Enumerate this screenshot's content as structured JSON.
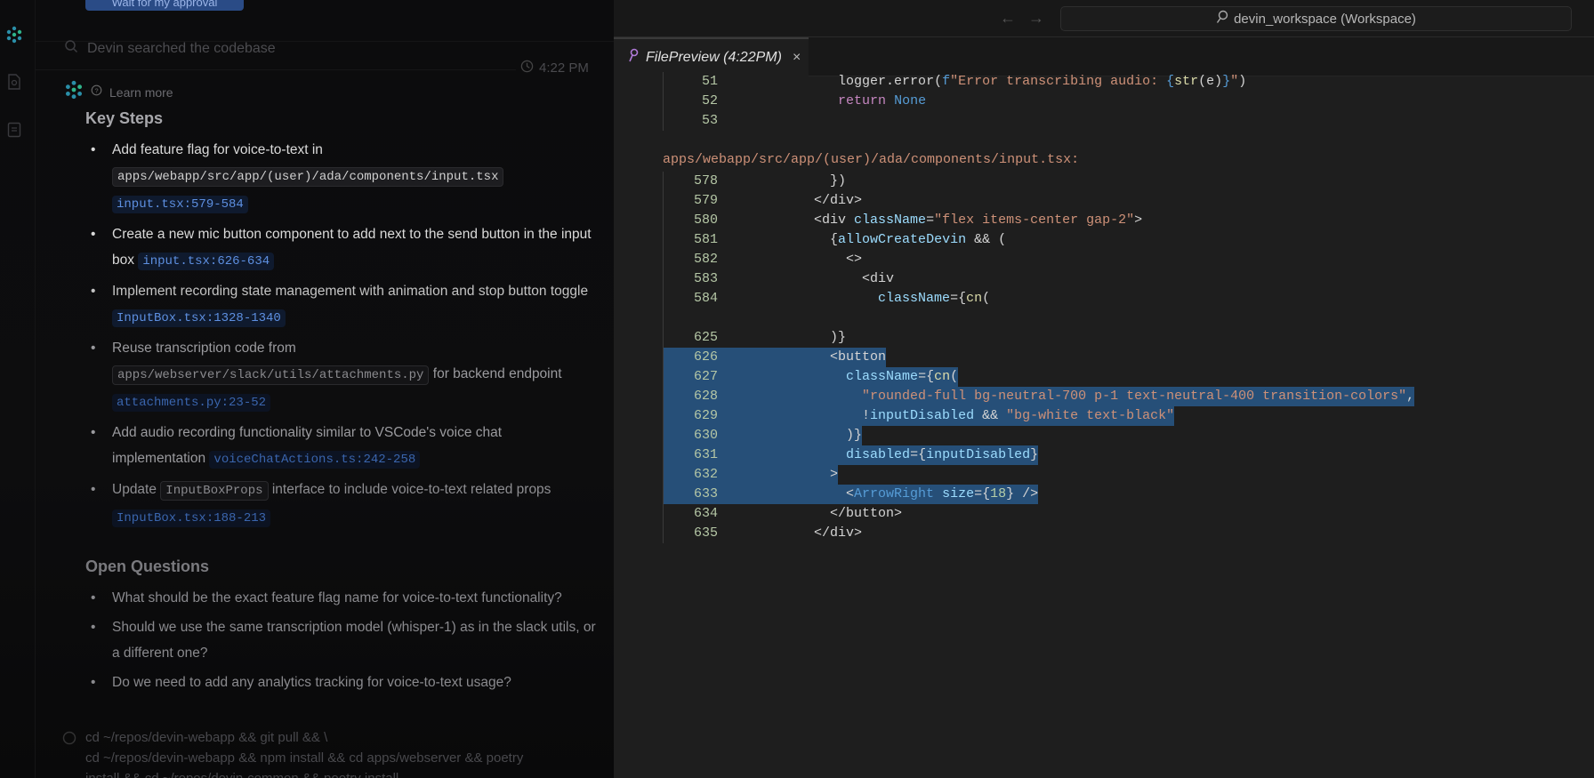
{
  "chat": {
    "approval_button": "Wait for my approval",
    "searched_text": "Devin searched the codebase",
    "timestamp": "4:22 PM",
    "learn_more": "Learn more",
    "key_steps_title": "Key Steps",
    "key_steps": [
      {
        "parts": [
          {
            "type": "text",
            "v": "Add feature flag for voice-to-text in "
          },
          {
            "type": "code",
            "v": "apps/webapp/src/app/(user)/ada/components/input.tsx"
          },
          {
            "type": "text",
            "v": " "
          },
          {
            "type": "link",
            "v": "input.tsx:579-584"
          }
        ]
      },
      {
        "parts": [
          {
            "type": "text",
            "v": "Create a new mic button component to add next to the send button in the input box "
          },
          {
            "type": "link",
            "v": "input.tsx:626-634"
          }
        ]
      },
      {
        "parts": [
          {
            "type": "text",
            "v": "Implement recording state management with animation and stop button toggle "
          },
          {
            "type": "link",
            "v": "InputBox.tsx:1328-1340"
          }
        ]
      },
      {
        "parts": [
          {
            "type": "text",
            "v": "Reuse transcription code from "
          },
          {
            "type": "code",
            "v": "apps/webserver/slack/utils/attachments.py"
          },
          {
            "type": "text",
            "v": " for backend endpoint "
          },
          {
            "type": "link",
            "v": "attachments.py:23-52"
          }
        ]
      },
      {
        "parts": [
          {
            "type": "text",
            "v": "Add audio recording functionality similar to VSCode's voice chat implementation "
          },
          {
            "type": "link",
            "v": "voiceChatActions.ts:242-258"
          }
        ]
      },
      {
        "parts": [
          {
            "type": "text",
            "v": "Update "
          },
          {
            "type": "code",
            "v": "InputBoxProps"
          },
          {
            "type": "text",
            "v": " interface to include voice-to-text related props "
          },
          {
            "type": "link",
            "v": "InputBox.tsx:188-213"
          }
        ]
      }
    ],
    "open_questions_title": "Open Questions",
    "open_questions": [
      "What should be the exact feature flag name for voice-to-text functionality?",
      "Should we use the same transcription model (whisper-1) as in the slack utils, or a different one?",
      "Do we need to add any analytics tracking for voice-to-text usage?"
    ],
    "command_lines": [
      "cd ~/repos/devin-webapp && git pull && \\",
      "cd ~/repos/devin-webapp && npm install && cd apps/webserver && poetry",
      "install && cd ~/repos/devin-common && poetry install"
    ]
  },
  "workspace": {
    "search_label": "devin_workspace (Workspace)",
    "tab_label": "FilePreview (4:22PM)",
    "tab_close": "×"
  },
  "code": {
    "blocks": [
      {
        "header": null,
        "lines": [
          {
            "n": "51",
            "sel": false,
            "tokens": [
              [
                "           ",
                "def"
              ],
              [
                "logger.error(",
                "def"
              ],
              [
                "f",
                "const"
              ],
              [
                "\"Error transcribing audio: ",
                "str"
              ],
              [
                "{",
                "const"
              ],
              [
                "str",
                "fn"
              ],
              [
                "(e)",
                "def"
              ],
              [
                "}",
                "const"
              ],
              [
                "\"",
                "str"
              ],
              [
                ")",
                "def"
              ]
            ]
          },
          {
            "n": "52",
            "sel": false,
            "tokens": [
              [
                "           ",
                "def"
              ],
              [
                "return",
                "kw"
              ],
              [
                " ",
                "def"
              ],
              [
                "None",
                "const"
              ]
            ]
          },
          {
            "n": "53",
            "sel": false,
            "tokens": []
          }
        ]
      },
      {
        "header": "apps/webapp/src/app/(user)/ada/components/input.tsx:",
        "lines": [
          {
            "n": "578",
            "sel": false,
            "tokens": [
              [
                "          })",
                "def"
              ]
            ]
          },
          {
            "n": "579",
            "sel": false,
            "tokens": [
              [
                "        </div>",
                "def"
              ]
            ]
          },
          {
            "n": "580",
            "sel": false,
            "tokens": [
              [
                "        <div ",
                "def"
              ],
              [
                "className",
                "attr"
              ],
              [
                "=",
                "def"
              ],
              [
                "\"flex items-center gap-2\"",
                "str"
              ],
              [
                ">",
                "def"
              ]
            ]
          },
          {
            "n": "581",
            "sel": false,
            "tokens": [
              [
                "          {",
                "def"
              ],
              [
                "allowCreateDevin",
                "attr"
              ],
              [
                " && (",
                "def"
              ]
            ]
          },
          {
            "n": "582",
            "sel": false,
            "tokens": [
              [
                "            <>",
                "def"
              ]
            ]
          },
          {
            "n": "583",
            "sel": false,
            "tokens": [
              [
                "              <div",
                "def"
              ]
            ]
          },
          {
            "n": "584",
            "sel": false,
            "tokens": [
              [
                "                ",
                "def"
              ],
              [
                "className",
                "attr"
              ],
              [
                "={",
                "def"
              ],
              [
                "cn",
                "fn"
              ],
              [
                "(",
                "def"
              ]
            ]
          },
          {
            "n": "",
            "sel": false,
            "tokens": []
          },
          {
            "n": "625",
            "sel": false,
            "tokens": [
              [
                "          )}",
                "def"
              ]
            ]
          },
          {
            "n": "626",
            "sel": true,
            "tokens": [
              [
                "          <button",
                "def"
              ]
            ]
          },
          {
            "n": "627",
            "sel": true,
            "tokens": [
              [
                "            ",
                "def"
              ],
              [
                "className",
                "attr"
              ],
              [
                "={",
                "def"
              ],
              [
                "cn",
                "fn"
              ],
              [
                "(",
                "def"
              ]
            ]
          },
          {
            "n": "628",
            "sel": true,
            "tokens": [
              [
                "              ",
                "def"
              ],
              [
                "\"rounded-full bg-neutral-700 p-1 text-neutral-400 transition-colors\"",
                "str"
              ],
              [
                ",",
                "def"
              ]
            ]
          },
          {
            "n": "629",
            "sel": true,
            "tokens": [
              [
                "              !",
                "def"
              ],
              [
                "inputDisabled",
                "attr"
              ],
              [
                " && ",
                "def"
              ],
              [
                "\"bg-white text-black\"",
                "str"
              ]
            ]
          },
          {
            "n": "630",
            "sel": true,
            "tokens": [
              [
                "            )}",
                "def"
              ]
            ]
          },
          {
            "n": "631",
            "sel": true,
            "tokens": [
              [
                "            ",
                "def"
              ],
              [
                "disabled",
                "attr"
              ],
              [
                "={",
                "def"
              ],
              [
                "inputDisabled",
                "attr"
              ],
              [
                "}",
                "def"
              ]
            ]
          },
          {
            "n": "632",
            "sel": true,
            "tokens": [
              [
                "          >",
                "def"
              ]
            ]
          },
          {
            "n": "633",
            "sel": true,
            "tokens": [
              [
                "            <",
                "def"
              ],
              [
                "ArrowRight",
                "const"
              ],
              [
                " ",
                "def"
              ],
              [
                "size",
                "attr"
              ],
              [
                "={",
                "def"
              ],
              [
                "18",
                "num"
              ],
              [
                "} />",
                "def"
              ]
            ]
          },
          {
            "n": "634",
            "sel": false,
            "tokens": [
              [
                "          </button>",
                "def"
              ]
            ]
          },
          {
            "n": "635",
            "sel": false,
            "tokens": [
              [
                "        </div>",
                "def"
              ]
            ]
          }
        ]
      }
    ]
  },
  "colors": {
    "accent": "#264f78",
    "link": "#5d8fe0",
    "file_header": "#ce9178"
  }
}
